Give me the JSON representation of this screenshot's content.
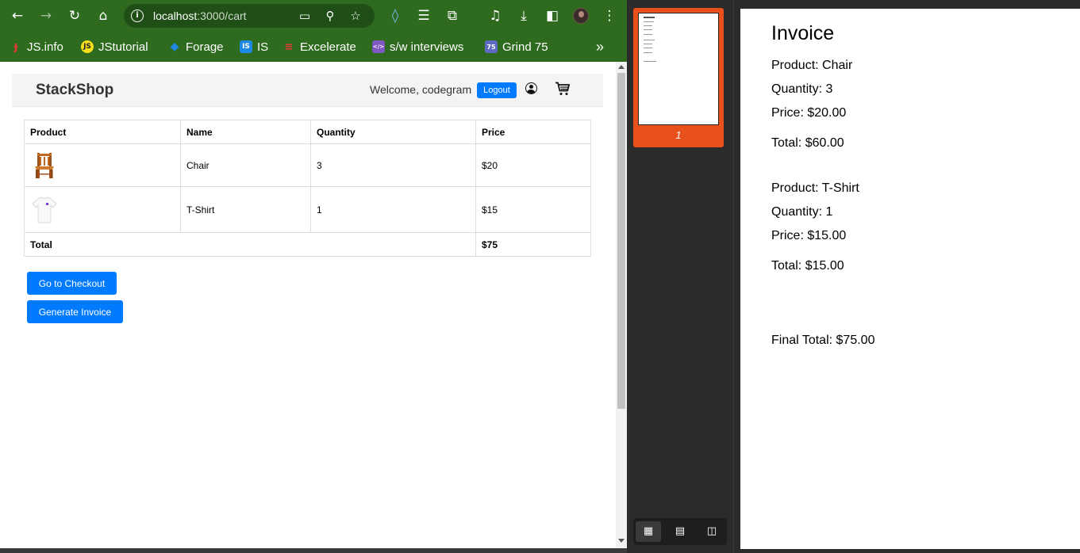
{
  "browser": {
    "url_host": "localhost",
    "url_path": ":3000/cart",
    "bookmarks": [
      {
        "label": "JS.info",
        "icon": "js-info-icon",
        "color": "#c0392b"
      },
      {
        "label": "JStutorial",
        "icon": "js-tutorial-icon",
        "color": "#f7df1e"
      },
      {
        "label": "Forage",
        "icon": "forage-icon",
        "color": "#1e88e5"
      },
      {
        "label": "IS",
        "icon": "is-icon",
        "color": "#1e88e5"
      },
      {
        "label": "Excelerate",
        "icon": "excelerate-icon",
        "color": "#e53935"
      },
      {
        "label": "s/w interviews",
        "icon": "code-icon",
        "color": "#7e57c2"
      },
      {
        "label": "Grind 75",
        "icon": "grind75-icon",
        "color": "#5c6bc0"
      }
    ],
    "bookmark_badges": {
      "js": "JS",
      "is": "IS",
      "g75": "75",
      "code": "</>"
    },
    "more_bookmarks": "»"
  },
  "shop": {
    "brand": "StackShop",
    "welcome": "Welcome, codegram",
    "logout_label": "Logout",
    "accent": "#007bff"
  },
  "cart": {
    "headers": [
      "Product",
      "Name",
      "Quantity",
      "Price"
    ],
    "rows": [
      {
        "image": "chair-image",
        "name": "Chair",
        "quantity": "3",
        "price": "$20"
      },
      {
        "image": "tshirt-image",
        "name": "T-Shirt",
        "quantity": "1",
        "price": "$15"
      }
    ],
    "total_label": "Total",
    "total_value": "$75",
    "checkout_label": "Go to Checkout",
    "invoice_label": "Generate Invoice"
  },
  "pdf": {
    "title": "Invoice",
    "items": [
      {
        "product": "Product: Chair",
        "quantity": "Quantity: 3",
        "price": "Price: $20.00",
        "total": "Total: $60.00"
      },
      {
        "product": "Product: T-Shirt",
        "quantity": "Quantity: 1",
        "price": "Price: $15.00",
        "total": "Total: $15.00"
      }
    ],
    "final_total": "Final Total: $75.00",
    "page_number": "1",
    "thumbnail_accent": "#e8501c"
  }
}
